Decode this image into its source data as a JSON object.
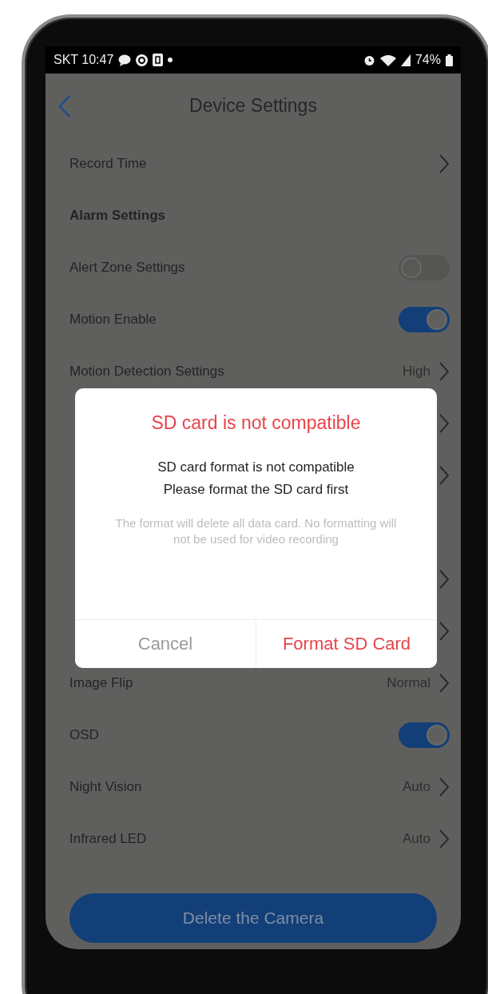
{
  "status_bar": {
    "carrier_time": "SKT 10:47",
    "battery_text": "74%"
  },
  "header": {
    "title": "Device Settings"
  },
  "rows": [
    {
      "kind": "link",
      "label": "Record Time"
    },
    {
      "kind": "section",
      "label": "Alarm Settings"
    },
    {
      "kind": "toggle",
      "label": "Alert Zone Settings",
      "on": false
    },
    {
      "kind": "toggle",
      "label": "Motion Enable",
      "on": true
    },
    {
      "kind": "link",
      "label": "Motion Detection Settings",
      "value": "High"
    },
    {
      "kind": "link"
    },
    {
      "kind": "link"
    },
    {
      "kind": "section"
    },
    {
      "kind": "link"
    },
    {
      "kind": "link"
    },
    {
      "kind": "link",
      "label": "Image Flip",
      "value": "Normal"
    },
    {
      "kind": "toggle",
      "label": "OSD",
      "on": true
    },
    {
      "kind": "link",
      "label": "Night Vision",
      "value": "Auto"
    },
    {
      "kind": "link",
      "label": "Infrared LED",
      "value": "Auto"
    }
  ],
  "delete_button": "Delete the Camera",
  "dialog": {
    "title": "SD card is not compatible",
    "message_lines": [
      "SD card format is not compatible",
      "Please format the SD card first"
    ],
    "hint_lines": [
      "The format will delete all data card. No formatting will",
      "not be used for video recording"
    ],
    "buttons": [
      {
        "kind": "cancel",
        "label": "Cancel"
      },
      {
        "kind": "confirm",
        "label": "Format SD Card"
      }
    ]
  }
}
